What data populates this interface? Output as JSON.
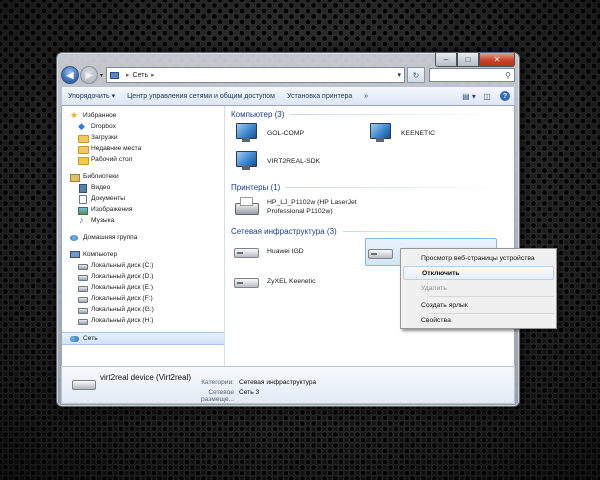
{
  "window": {
    "address": {
      "location": "Сеть",
      "separator": "▸"
    },
    "search_placeholder": ""
  },
  "toolbar": {
    "organize": "Упорядочить ▾",
    "network_center": "Центр управления сетями и общим доступом",
    "add_printer": "Установка принтера",
    "more": "»"
  },
  "navpane": {
    "favorites": "Избранное",
    "favorites_items": [
      "Dropbox",
      "Загрузки",
      "Недавние места",
      "Рабочий стол"
    ],
    "libraries": "Библиотеки",
    "libraries_items": [
      "Видео",
      "Документы",
      "Изображения",
      "Музыка"
    ],
    "homegroup": "Домашняя группа",
    "computer": "Компьютер",
    "drives": [
      "Локальный диск (C:)",
      "Локальный диск (D:)",
      "Локальный диск (E:)",
      "Локальный диск (F:)",
      "Локальный диск (G:)",
      "Локальный диск (H:)"
    ],
    "network": "Сеть"
  },
  "groups": {
    "computer": {
      "header": "Компьютер (3)",
      "items": [
        "GOL-COMP",
        "KEENETIC",
        "VIRT2REAL-SDK"
      ]
    },
    "printers": {
      "header": "Принтеры (1)",
      "items": [
        {
          "line1": "HP_LJ_P1102w (HP LaserJet",
          "line2": "Professional P1102w)"
        }
      ]
    },
    "infrastructure": {
      "header": "Сетевая инфраструктура (3)",
      "items": [
        "Huawei IGD",
        "v",
        "ZyXEL Keenetic"
      ]
    }
  },
  "context_menu": {
    "items": [
      "Просмотр веб-страницы устройства",
      "Отключить",
      "Удалить",
      "Создать ярлык",
      "Свойства"
    ]
  },
  "details": {
    "title": "virt2real device (Virt2real)",
    "category_label": "Категории:",
    "category_value": "Сетевая инфраструктура",
    "location_label": "Сетевое размеще...",
    "location_value": "Сеть 3"
  }
}
